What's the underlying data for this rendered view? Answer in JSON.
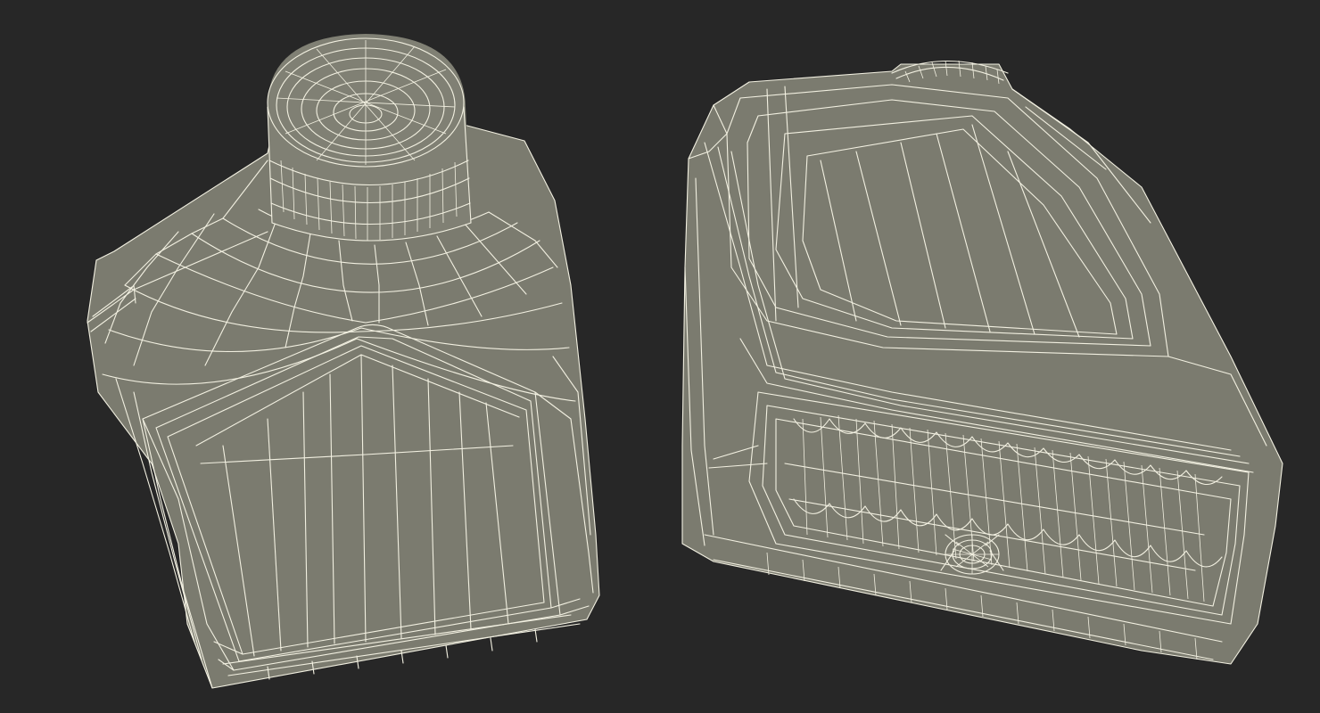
{
  "scene": {
    "background_color": "#272727",
    "mesh_fill_color": "#7b7b6f",
    "wire_color": "#f2f0e1",
    "objects": [
      {
        "name": "bottle-view-front",
        "render_style": "wireframe-over-shaded"
      },
      {
        "name": "bottle-view-bottom",
        "render_style": "wireframe-over-shaded"
      }
    ]
  }
}
